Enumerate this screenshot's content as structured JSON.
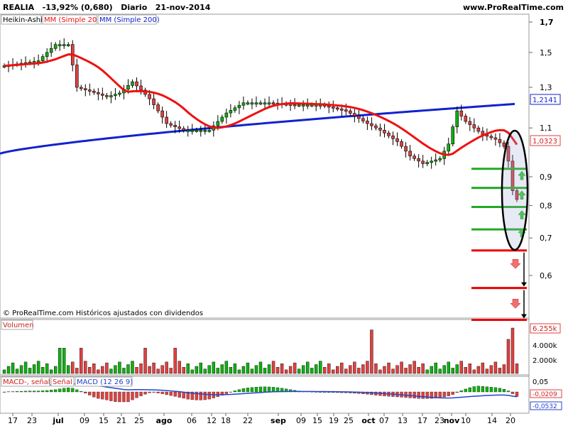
{
  "header": {
    "symbol": "REALIA",
    "change": "-13,92% (0,680)",
    "period": "Diario",
    "date": "21-nov-2014",
    "site": "www.ProRealTime.com"
  },
  "legend": {
    "heikin": "Heikin-Ashi",
    "mm20": "MM (Simple 20)",
    "mm200": "MM (Simple 200)",
    "footer": "© ProRealTime.com Históricos ajustados con dividendos"
  },
  "volume_panel": {
    "label": "Volumen",
    "ticks": [
      "4.000k",
      "2.000k"
    ],
    "last_value": "6.255k"
  },
  "macd_panel": {
    "labels": [
      "MACD-, señal",
      "Señal",
      "MACD (12 26 9)"
    ],
    "ticks": [
      "0,05",
      "0"
    ],
    "values": [
      "-0,0209",
      "-0,0532"
    ]
  },
  "colors": {
    "up": "#10b010",
    "down": "#e04040",
    "mm20": "#ee1111",
    "mm200": "#1122cc",
    "level_green": "#22aa22",
    "level_red": "#ee0000",
    "macd_line": "#2244cc"
  },
  "chart_data": {
    "type": "candlestick",
    "title": "REALIA",
    "y_ticks": [
      "1,7",
      "1,5",
      "1,3",
      "1,1",
      "0,9",
      "0,8",
      "0,7",
      "0,6"
    ],
    "ylim": [
      0.5,
      1.75
    ],
    "x_ticks": [
      "17",
      "23",
      "jul",
      "09",
      "15",
      "21",
      "25",
      "ago",
      "06",
      "12",
      "18",
      "22",
      "sep",
      "09",
      "15",
      "19",
      "25",
      "oct",
      "07",
      "13",
      "17",
      "23",
      "nov",
      "10",
      "14",
      "20"
    ],
    "last_price": "1,0323",
    "mm200_label": "1,2141",
    "horizontal_levels": {
      "green": [
        0.93,
        0.86,
        0.795,
        0.725
      ],
      "red": [
        0.665,
        0.57,
        0.5
      ]
    },
    "series": [
      {
        "name": "Heikin-Ashi"
      },
      {
        "name": "MM (Simple 20)"
      },
      {
        "name": "MM (Simple 200)"
      }
    ]
  }
}
